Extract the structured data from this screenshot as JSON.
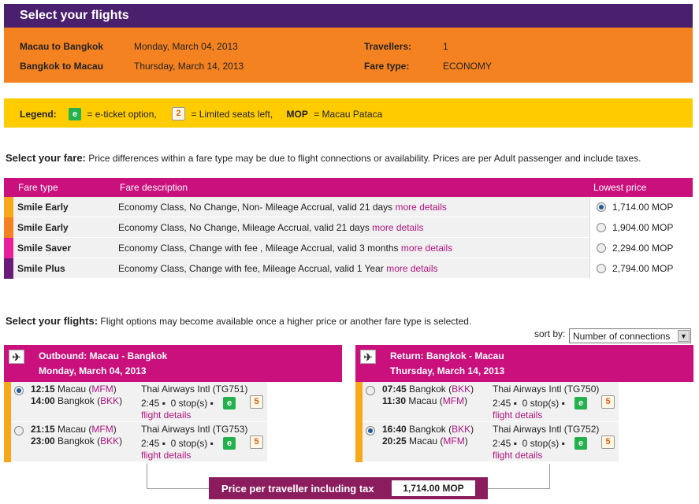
{
  "header": {
    "title": "Select your flights"
  },
  "trip": {
    "leg1_route": "Macau to Bangkok",
    "leg1_date": "Monday, March 04, 2013",
    "leg2_route": "Bangkok to Macau",
    "leg2_date": "Thursday, March 14, 2013",
    "travellers_label": "Travellers:",
    "travellers_value": "1",
    "fare_type_label": "Fare type:",
    "fare_type_value": "ECONOMY"
  },
  "legend": {
    "label": "Legend:",
    "e_icon": "e",
    "e_text": "= e-ticket option,",
    "seat_icon": "2",
    "seat_text": "= Limited seats left,",
    "mop": "MOP",
    "mop_text": "= Macau Pataca"
  },
  "fare_intro": {
    "bold": "Select your fare:",
    "text": "Price differences within a fare type may be due to flight connections or availability. Prices are per Adult passenger and include taxes."
  },
  "fare_table": {
    "headers": [
      "Fare type",
      "Fare description",
      "Lowest price"
    ],
    "more_label": "more details",
    "rows": [
      {
        "type": "Smile Early",
        "desc": "Economy Class, No Change, Non- Mileage Accrual, valid 21 days",
        "price": "1,714.00 MOP",
        "color": "#f7a81b",
        "selected": true
      },
      {
        "type": "Smile Early",
        "desc": "Economy Class, No Change, Mileage Accrual, valid 21 days",
        "price": "1,904.00 MOP",
        "color": "#f58220",
        "selected": false
      },
      {
        "type": "Smile Saver",
        "desc": "Economy Class, Change with fee , Mileage Accrual, valid 3 months",
        "price": "2,294.00 MOP",
        "color": "#e8219a",
        "selected": false
      },
      {
        "type": "Smile Plus",
        "desc": "Economy Class, Change with fee, Mileage Accrual, valid 1 Year",
        "price": "2,794.00 MOP",
        "color": "#6a1b7a",
        "selected": false
      }
    ]
  },
  "flights_intro": {
    "bold": "Select your flights:",
    "text": "Flight options may become available once a higher price or another fare type is selected."
  },
  "sort": {
    "label": "sort by:",
    "value": "Number of connections"
  },
  "outbound": {
    "title": "Outbound: Macau - Bangkok",
    "date": "Monday, March 04, 2013",
    "flights": [
      {
        "dep_time": "12:15",
        "dep_city": "Macau",
        "dep_code": "MFM",
        "arr_time": "14:00",
        "arr_city": "Bangkok",
        "arr_code": "BKK",
        "airline": "Thai Airways Intl (TG751)",
        "duration": "2:45",
        "stops": "0 stop(s)",
        "details": "flight details",
        "seats": "5",
        "selected": true
      },
      {
        "dep_time": "21:15",
        "dep_city": "Macau",
        "dep_code": "MFM",
        "arr_time": "23:00",
        "arr_city": "Bangkok",
        "arr_code": "BKK",
        "airline": "Thai Airways Intl (TG753)",
        "duration": "2:45",
        "stops": "0 stop(s)",
        "details": "flight details",
        "seats": "5",
        "selected": false
      }
    ]
  },
  "return": {
    "title": "Return: Bangkok - Macau",
    "date": "Thursday, March 14, 2013",
    "flights": [
      {
        "dep_time": "07:45",
        "dep_city": "Bangkok",
        "dep_code": "BKK",
        "arr_time": "11:30",
        "arr_city": "Macau",
        "arr_code": "MFM",
        "airline": "Thai Airways Intl (TG750)",
        "duration": "2:45",
        "stops": "0 stop(s)",
        "details": "flight details",
        "seats": "5",
        "selected": false
      },
      {
        "dep_time": "16:40",
        "dep_city": "Bangkok",
        "dep_code": "BKK",
        "arr_time": "20:25",
        "arr_city": "Macau",
        "arr_code": "MFM",
        "airline": "Thai Airways Intl (TG752)",
        "duration": "2:45",
        "stops": "0 stop(s)",
        "details": "flight details",
        "seats": "5",
        "selected": true
      }
    ]
  },
  "price_bar": {
    "label": "Price per traveller including tax",
    "value": "1,714.00 MOP"
  },
  "icons": {
    "plane": "airplane-icon",
    "e": "e-ticket-icon",
    "seat": "limited-seats-icon"
  }
}
